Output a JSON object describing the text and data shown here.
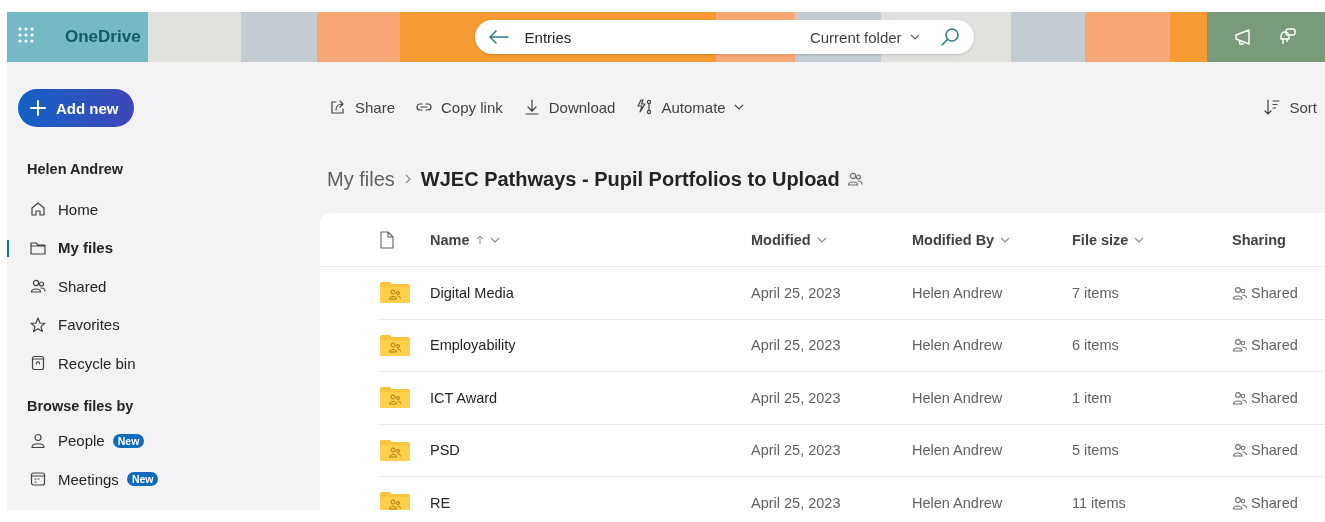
{
  "header": {
    "app_name": "OneDrive",
    "search": {
      "value": "Entries",
      "scope": "Current folder"
    }
  },
  "command_bar": [
    {
      "label": "Share",
      "kind": "share",
      "menu": false
    },
    {
      "label": "Copy link",
      "kind": "link",
      "menu": false
    },
    {
      "label": "Download",
      "kind": "download",
      "menu": false
    },
    {
      "label": "Automate",
      "kind": "automate",
      "menu": true
    }
  ],
  "sort": {
    "label": "Sort"
  },
  "sidebar": {
    "add_button": "Add new",
    "user_name": "Helen Andrew",
    "nav": [
      {
        "label": "Home",
        "kind": "home",
        "selected": false
      },
      {
        "label": "My files",
        "kind": "folder",
        "selected": true
      },
      {
        "label": "Shared",
        "kind": "people",
        "selected": false
      },
      {
        "label": "Favorites",
        "kind": "star",
        "selected": false
      },
      {
        "label": "Recycle bin",
        "kind": "bin",
        "selected": false
      }
    ],
    "section_title": "Browse files by",
    "browse": [
      {
        "label": "People",
        "kind": "person",
        "badge": "New"
      },
      {
        "label": "Meetings",
        "kind": "calendar",
        "badge": "New"
      }
    ]
  },
  "breadcrumb": [
    "My files",
    "WJEC Pathways - Pupil Portfolios to Upload"
  ],
  "table": {
    "columns": [
      {
        "label": "Name",
        "sorted": true,
        "menu": true
      },
      {
        "label": "Modified",
        "sorted": false,
        "menu": true
      },
      {
        "label": "Modified By",
        "sorted": false,
        "menu": true
      },
      {
        "label": "File size",
        "sorted": false,
        "menu": true
      },
      {
        "label": "Sharing",
        "sorted": false,
        "menu": false
      }
    ],
    "rows": [
      {
        "name": "Digital Media",
        "modified": "April 25, 2023",
        "modified_by": "Helen Andrew",
        "size": "7 items",
        "sharing": "Shared"
      },
      {
        "name": "Employability",
        "modified": "April 25, 2023",
        "modified_by": "Helen Andrew",
        "size": "6 items",
        "sharing": "Shared"
      },
      {
        "name": "ICT Award",
        "modified": "April 25, 2023",
        "modified_by": "Helen Andrew",
        "size": "1 item",
        "sharing": "Shared"
      },
      {
        "name": "PSD",
        "modified": "April 25, 2023",
        "modified_by": "Helen Andrew",
        "size": "5 items",
        "sharing": "Shared"
      },
      {
        "name": "RE",
        "modified": "April 25, 2023",
        "modified_by": "Helen Andrew",
        "size": "11 items",
        "sharing": "Shared"
      }
    ]
  }
}
